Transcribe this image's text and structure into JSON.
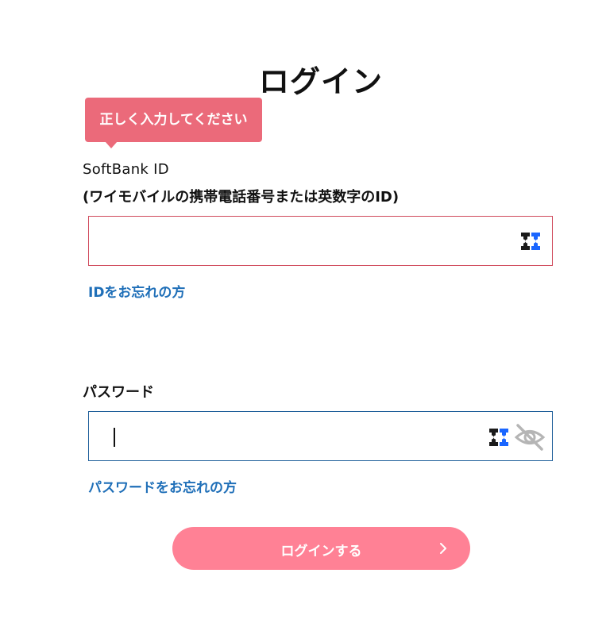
{
  "page": {
    "title": "ログイン"
  },
  "tooltip": {
    "message": "正しく入力してください"
  },
  "id_section": {
    "label": "SoftBank ID",
    "sub_label": "(ワイモバイルの携帯電話番号または英数字のID)",
    "value": "",
    "forgot_link": "IDをお忘れの方",
    "password_manager_icon": "password-manager-icon"
  },
  "password_section": {
    "label": "パスワード",
    "value": "",
    "forgot_link": "パスワードをお忘れの方",
    "password_manager_icon": "password-manager-icon",
    "visibility_icon": "eye-slash-icon"
  },
  "login_button": {
    "label": "ログインする",
    "icon": "chevron-right-icon"
  },
  "colors": {
    "error": "#d04a5c",
    "tooltip_bg": "#eb6a7a",
    "focus_border": "#1f5f9a",
    "link": "#1f6fb8",
    "button_bg": "#ff8195",
    "password_manager_blue": "#1a66ff"
  }
}
